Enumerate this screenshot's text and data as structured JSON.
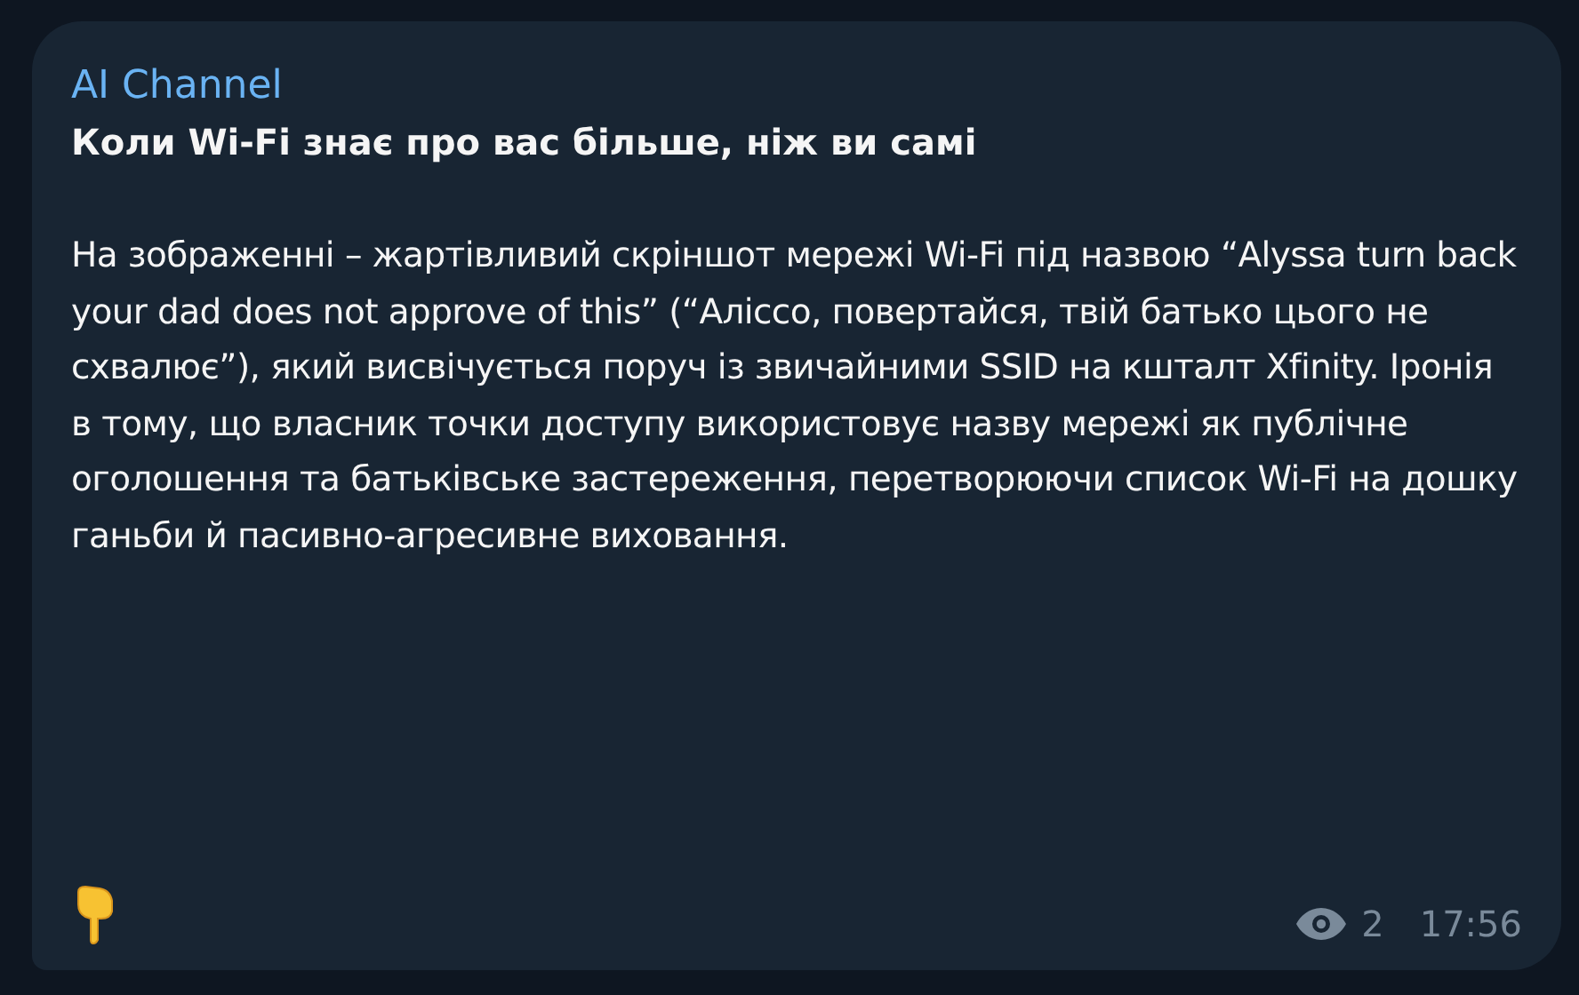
{
  "message": {
    "channel": "AI Channel",
    "headline": "Коли Wi-Fi знає про вас більше, ніж ви самі",
    "body": "На зображенні – жартівливий скріншот мережі Wi-Fi під назвою “Alyssa turn back your dad does not approve of this” (“Алісcо, повертайся, твій батько цього не схвалює”), який висвічується поруч із звичайними SSID на кшталт Xfinity. Іронія в тому, що власник точки доступу використовує назву мережі як публічне оголошення та батьківське застереження, перетворюючи список Wi-Fi на дошку ганьби й пасивно-агресивне виховання.",
    "views": "2",
    "time": "17:56"
  }
}
